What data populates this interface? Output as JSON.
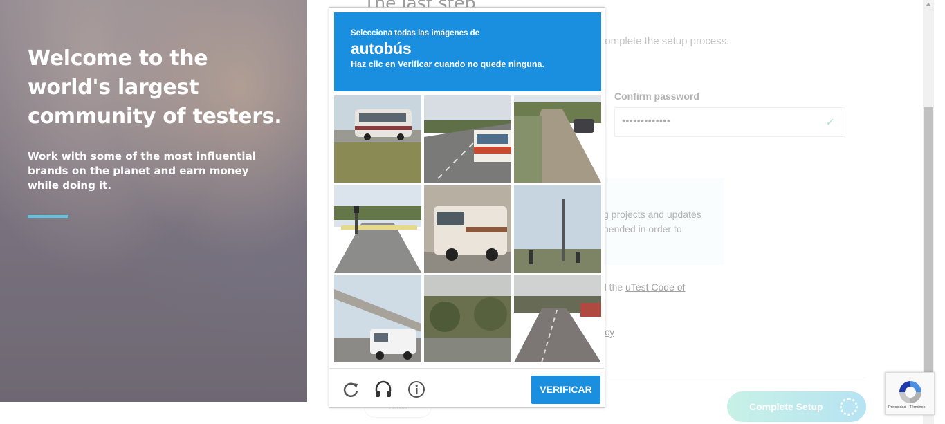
{
  "hero": {
    "title": "Welcome to the world's largest community of testers.",
    "subtitle": "Work with some of the most influential brands on the planet and earn money while doing it."
  },
  "form": {
    "step_title": "The last step",
    "intro": "account. Then review and accept our terms of use, complete the setup process.",
    "confirm_password_label": "Confirm password",
    "confirm_password_value": "•••••••••••••",
    "info_text": "g projects and updates nended in order to",
    "code_prefix": "d the ",
    "code_link": "uTest Code of",
    "policy_link": "icy",
    "back_label": "Back",
    "complete_label": "Complete Setup"
  },
  "captcha": {
    "instruction": "Selecciona todas las imágenes de",
    "target": "autobús",
    "hint": "Haz clic en Verificar cuando no quede ninguna.",
    "verify_label": "VERIFICAR",
    "tiles": [
      {
        "subject": "bus on road"
      },
      {
        "subject": "road with bus"
      },
      {
        "subject": "road"
      },
      {
        "subject": "crosswalk"
      },
      {
        "subject": "RV bus"
      },
      {
        "subject": "traffic lights"
      },
      {
        "subject": "overpass with van"
      },
      {
        "subject": "trees"
      },
      {
        "subject": "road"
      }
    ]
  },
  "badge": {
    "text": "Privacidad - Términos"
  },
  "colors": {
    "captcha_blue": "#1a8fdf",
    "accent_line": "#5fc3e0",
    "complete_start": "#8fe3cd",
    "complete_end": "#6cc7e6"
  }
}
